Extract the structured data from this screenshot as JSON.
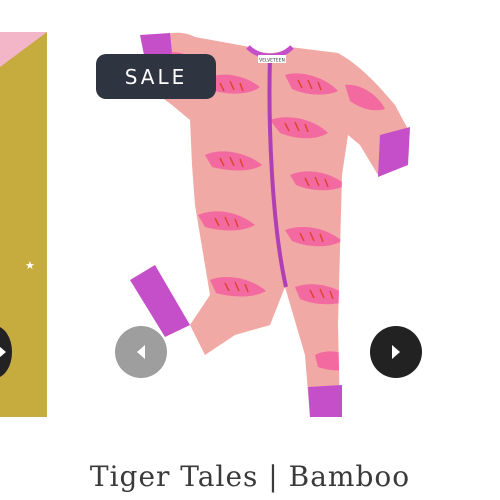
{
  "badge": {
    "label": "SALE"
  },
  "product": {
    "title": "Tiger Tales | Bamboo",
    "brand_tag": "VELVETEEN"
  },
  "carousel": {
    "prev_icon": "chevron-left-icon",
    "next_icon": "chevron-right-icon"
  },
  "colors": {
    "romper": "#f0a9a4",
    "trim": "#c54fc8",
    "tiger": "#f26aa0",
    "stripe": "#e0442f",
    "left_card": "#c6ac3e"
  }
}
